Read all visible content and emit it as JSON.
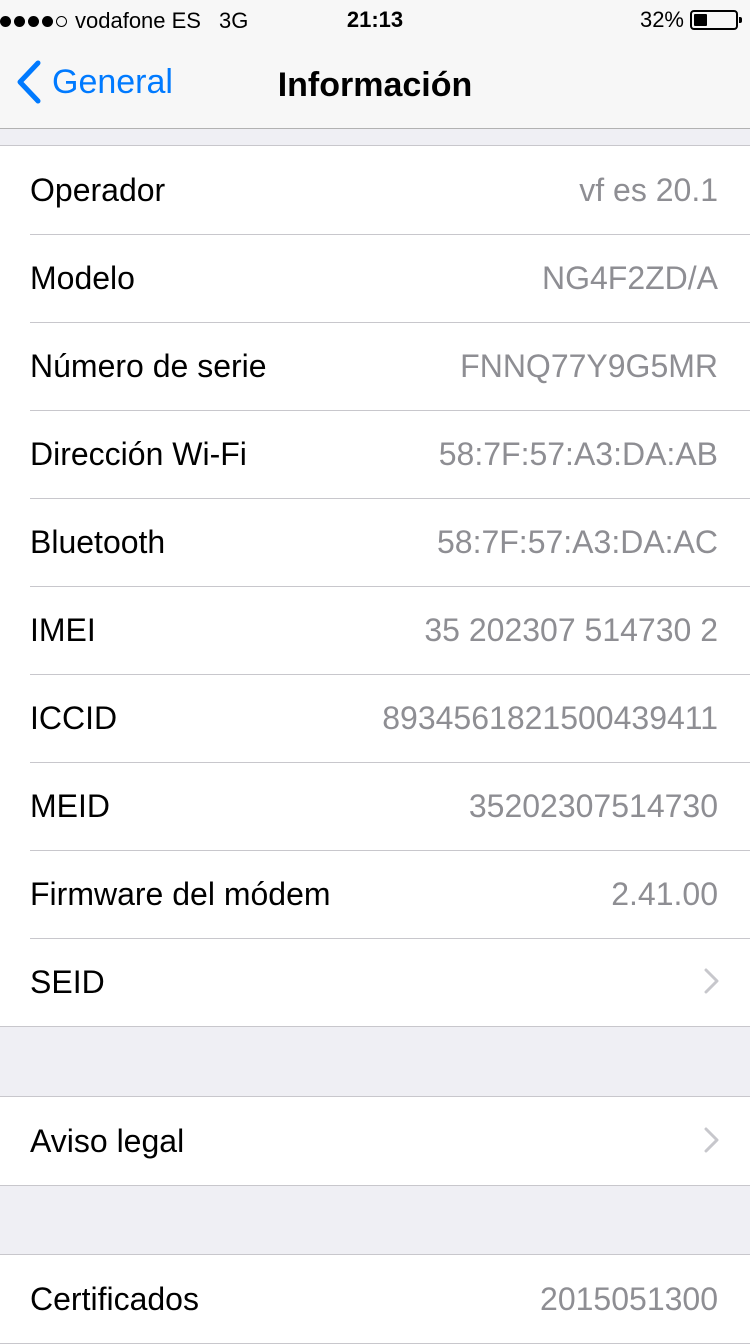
{
  "status_bar": {
    "carrier": "vodafone ES",
    "network": "3G",
    "time": "21:13",
    "battery_percent_label": "32%",
    "battery_level": 0.32,
    "signal_bars_filled": 4,
    "signal_bars_total": 5
  },
  "nav": {
    "back_label": "General",
    "title": "Información"
  },
  "colors": {
    "accent": "#007aff",
    "value_gray": "#8e8e93",
    "background": "#efeff4",
    "separator": "#c8c7cc"
  },
  "rows_main": [
    {
      "label": "Operador",
      "value": "vf es 20.1"
    },
    {
      "label": "Modelo",
      "value": "NG4F2ZD/A"
    },
    {
      "label": "Número de serie",
      "value": "FNNQ77Y9G5MR"
    },
    {
      "label": "Dirección Wi-Fi",
      "value": "58:7F:57:A3:DA:AB"
    },
    {
      "label": "Bluetooth",
      "value": "58:7F:57:A3:DA:AC"
    },
    {
      "label": "IMEI",
      "value": "35 202307 514730 2"
    },
    {
      "label": "ICCID",
      "value": "8934561821500439411"
    },
    {
      "label": "MEID",
      "value": "35202307514730"
    },
    {
      "label": "Firmware del módem",
      "value": "2.41.00"
    },
    {
      "label": "SEID",
      "icon": "chevron-right-icon"
    }
  ],
  "rows_legal": [
    {
      "label": "Aviso legal",
      "icon": "chevron-right-icon"
    }
  ],
  "rows_certs": [
    {
      "label": "Certificados",
      "value": "2015051300"
    }
  ]
}
